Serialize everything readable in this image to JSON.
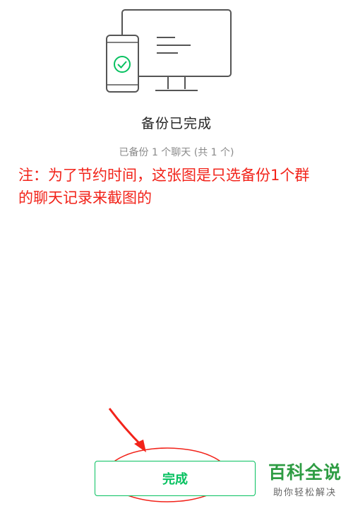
{
  "colors": {
    "accent": "#07c160",
    "annotation_red": "#f2231a",
    "watermark_green": "#2e9c43"
  },
  "illustration": {
    "icons": [
      "monitor-icon",
      "phone-icon",
      "checkmark-icon"
    ]
  },
  "status": {
    "title": "备份已完成",
    "subtitle": "已备份 1 个聊天 (共 1 个)"
  },
  "annotation": {
    "line1": "注：为了节约时间，这张图是只选备份1个群",
    "line2": "的聊天记录来截图的"
  },
  "actions": {
    "done_label": "完成"
  },
  "watermark": {
    "main": "百科全说",
    "sub": "助你轻松解决"
  }
}
